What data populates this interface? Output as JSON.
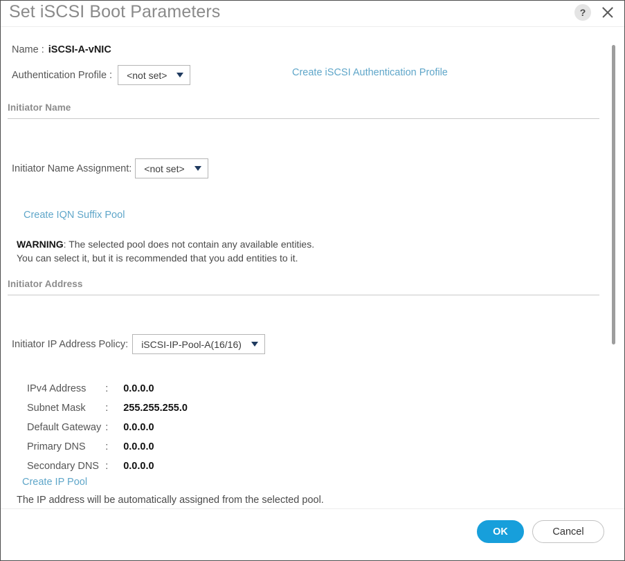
{
  "dialog": {
    "title": "Set iSCSI Boot Parameters",
    "help_icon_label": "?",
    "close_icon_label": "close-icon"
  },
  "name_row": {
    "label": "Name :",
    "value": "iSCSI-A-vNIC"
  },
  "auth_row": {
    "label": "Authentication Profile :",
    "selected": "<not set>",
    "create_link": "Create iSCSI Authentication Profile"
  },
  "initiator_name": {
    "section_title": "Initiator Name",
    "assignment_label": "Initiator Name Assignment:",
    "assignment_selected": "<not set>",
    "create_iqn_link": "Create IQN Suffix Pool",
    "warning_prefix": "WARNING",
    "warning_line1": ": The selected pool does not contain any available entities.",
    "warning_line2": "You can select it, but it is recommended that you add entities to it."
  },
  "initiator_address": {
    "section_title": "Initiator Address",
    "policy_label": "Initiator IP Address Policy:",
    "policy_selected": "iSCSI-IP-Pool-A(16/16)",
    "fields": [
      {
        "key": "IPv4 Address",
        "sep": ":",
        "value": "0.0.0.0"
      },
      {
        "key": "Subnet Mask",
        "sep": ":",
        "value": "255.255.255.0"
      },
      {
        "key": "Default Gateway",
        "sep": ":",
        "value": "0.0.0.0"
      },
      {
        "key": "Primary DNS",
        "sep": ":",
        "value": "0.0.0.0"
      },
      {
        "key": "Secondary DNS",
        "sep": ":",
        "value": "0.0.0.0"
      }
    ],
    "create_ip_pool_link": "Create IP Pool",
    "note": "The IP address will be automatically assigned from the selected pool."
  },
  "footer": {
    "ok_label": "OK",
    "cancel_label": "Cancel"
  },
  "colors": {
    "primary_button": "#179fdb",
    "link": "#5fa6c9",
    "title_text": "#8a8a8a",
    "caret": "#1f3a5f",
    "scrollbar_thumb": "#9d9d9d"
  }
}
